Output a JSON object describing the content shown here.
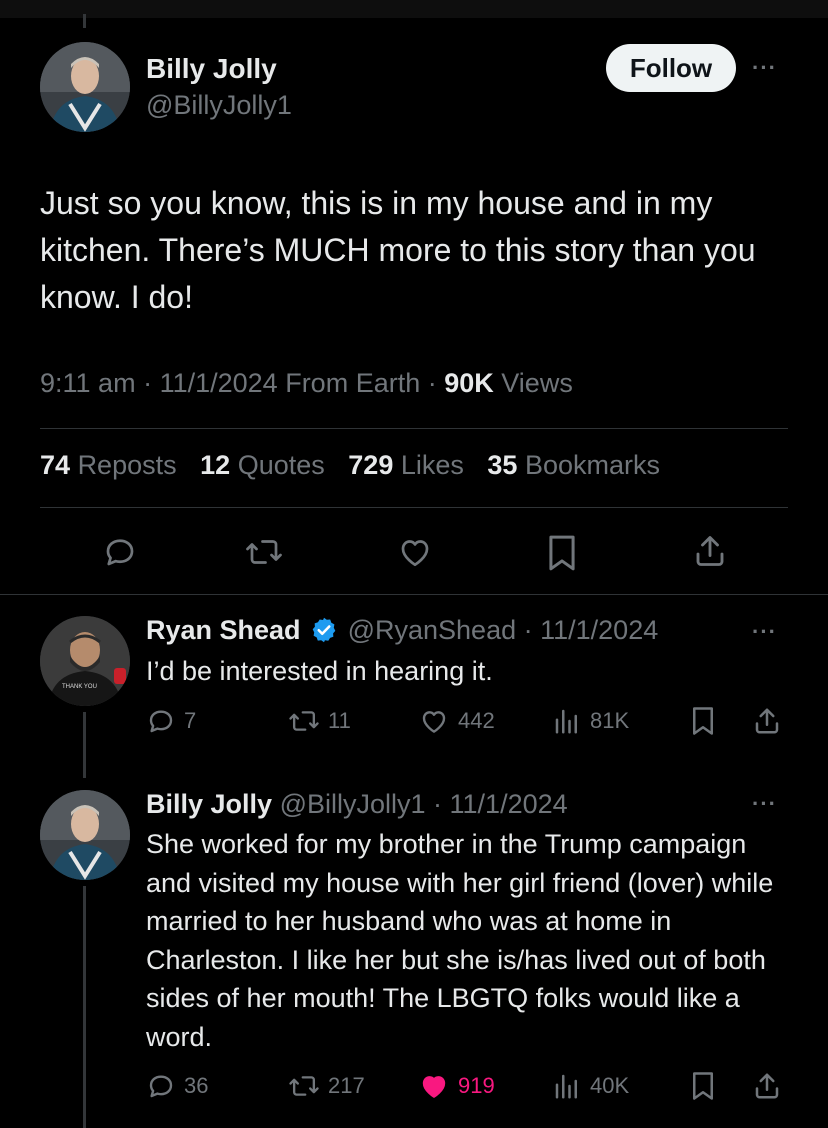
{
  "main_tweet": {
    "author_name": "Billy Jolly",
    "author_handle": "@BillyJolly1",
    "follow_label": "Follow",
    "text": "Just so you know, this is in my house and in my kitchen. There’s MUCH more to this story than you know. I do!",
    "time": "9:11 am",
    "date": "11/1/2024",
    "source": "From Earth",
    "views_count": "90K",
    "views_label": "Views",
    "stats": [
      {
        "count": "74",
        "label": "Reposts"
      },
      {
        "count": "12",
        "label": "Quotes"
      },
      {
        "count": "729",
        "label": "Likes"
      },
      {
        "count": "35",
        "label": "Bookmarks"
      }
    ]
  },
  "replies": [
    {
      "author_name": "Ryan Shead",
      "verified": true,
      "author_handle": "@RyanShead",
      "date": "11/1/2024",
      "text": "I’d be interested in hearing it.",
      "replies": "7",
      "reposts": "11",
      "likes": "442",
      "views": "81K",
      "liked": false,
      "avatar_shirt_text": "THANK YOU"
    },
    {
      "author_name": "Billy Jolly",
      "verified": false,
      "author_handle": "@BillyJolly1",
      "date": "11/1/2024",
      "text": "She worked for my brother in the Trump campaign and visited my house with her girl friend (lover) while married to her husband who was at home in Charleston. I like her but she is/has lived out of both sides of her mouth!  The LBGTQ folks would like a word.",
      "replies": "36",
      "reposts": "217",
      "likes": "919",
      "views": "40K",
      "liked": true
    }
  ],
  "colors": {
    "background": "#000000",
    "text": "#e7e9ea",
    "muted": "#71767b",
    "divider": "#2f3336",
    "verified": "#1d9bf0",
    "like": "#f91880"
  }
}
